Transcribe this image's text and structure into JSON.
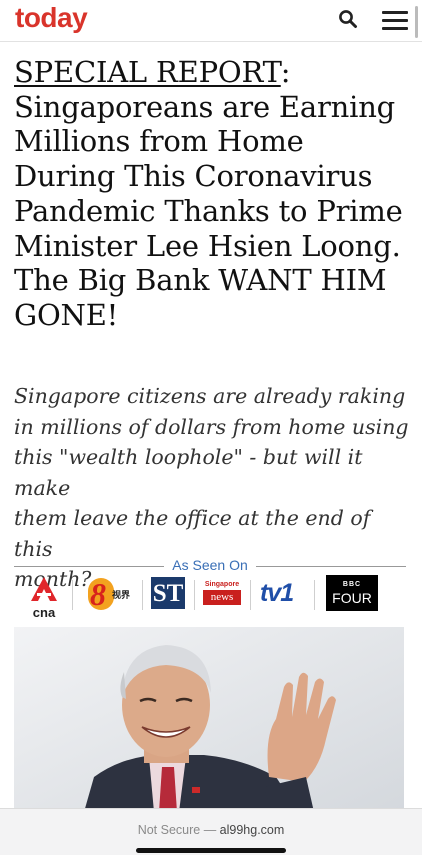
{
  "header": {
    "logo_text": "today",
    "logo_color": "#d9342b",
    "search_icon": "search-icon",
    "menu_icon": "hamburger-menu-icon"
  },
  "article": {
    "headline_tag": "SPECIAL REPORT",
    "headline_colon": ":",
    "headline_lines": [
      "Singaporeans are Earning",
      "Millions from Home",
      "During This Coronavirus",
      "Pandemic Thanks to Prime",
      "Minister Lee Hsien Loong.",
      "The Big Bank WANT HIM",
      "GONE!"
    ],
    "subhead_lines": [
      "Singapore citizens are already raking",
      "in millions of dollars from home using",
      "this \"wealth loophole\" - but will it make",
      "them leave the office at the end of this",
      "month?"
    ]
  },
  "as_seen_on": {
    "label": "As Seen On",
    "label_color": "#3a6fb6",
    "logos": [
      {
        "name": "cna",
        "text": "cna"
      },
      {
        "name": "channel-8",
        "text": "8",
        "subtext": "视界"
      },
      {
        "name": "straits-times",
        "text": "ST"
      },
      {
        "name": "singapore-news",
        "text": "Singapore",
        "subtext": "news"
      },
      {
        "name": "tv1",
        "text": "tv1"
      },
      {
        "name": "bbc-four",
        "text": "BBC",
        "subtext": "FOUR"
      }
    ]
  },
  "browser": {
    "security_text": "Not Secure",
    "separator": " — ",
    "domain": "al99hg.com"
  }
}
